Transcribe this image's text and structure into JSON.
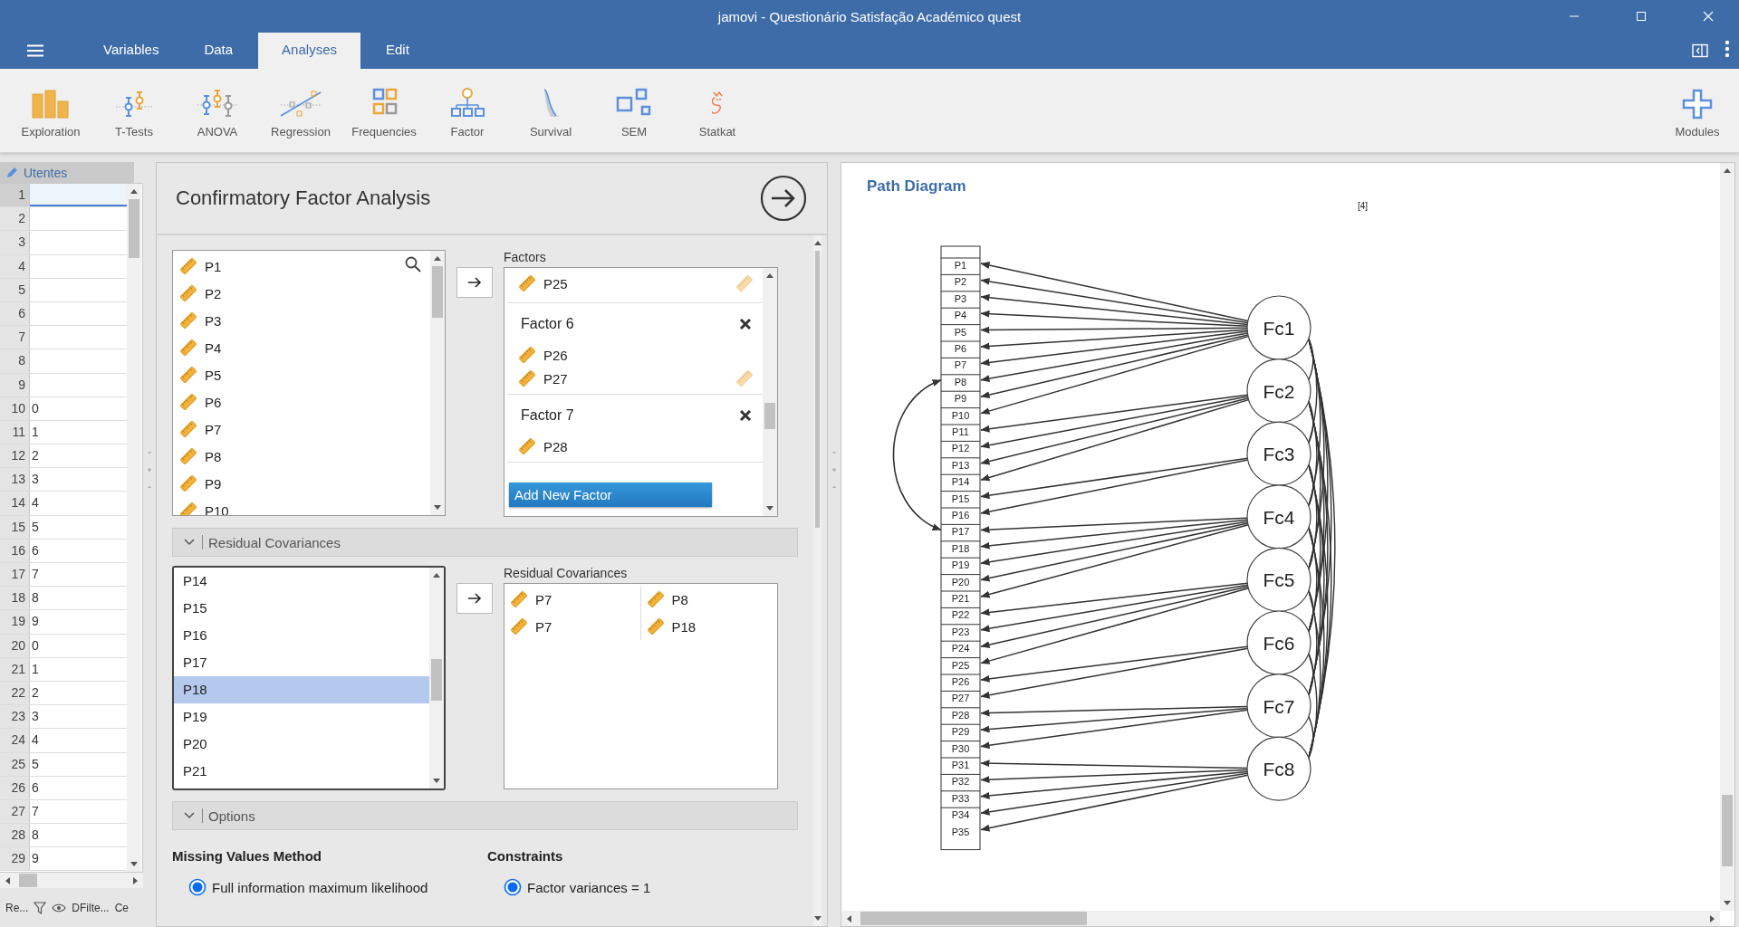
{
  "window": {
    "title": "jamovi - Questionário Satisfação Académico quest"
  },
  "tabs": [
    {
      "label": "Variables",
      "selected": false
    },
    {
      "label": "Data",
      "selected": false
    },
    {
      "label": "Analyses",
      "selected": true
    },
    {
      "label": "Edit",
      "selected": false
    }
  ],
  "ribbon": [
    {
      "kind": "exploration",
      "label": "Exploration"
    },
    {
      "kind": "ttests",
      "label": "T-Tests"
    },
    {
      "kind": "anova",
      "label": "ANOVA"
    },
    {
      "kind": "regression",
      "label": "Regression"
    },
    {
      "kind": "frequencies",
      "label": "Frequencies"
    },
    {
      "kind": "factor",
      "label": "Factor"
    },
    {
      "kind": "survival",
      "label": "Survival"
    },
    {
      "kind": "sem",
      "label": "SEM"
    },
    {
      "kind": "statkat",
      "label": "Statkat"
    },
    {
      "kind": "modules",
      "label": "Modules"
    }
  ],
  "spreadsheet": {
    "column": "Utentes",
    "rows": [
      {
        "number": "1",
        "selected": true
      },
      {
        "number": "2",
        "selected": false
      },
      {
        "number": "3",
        "selected": false
      },
      {
        "number": "4",
        "selected": false
      },
      {
        "number": "5",
        "selected": false
      },
      {
        "number": "6",
        "selected": false
      },
      {
        "number": "7",
        "selected": false
      },
      {
        "number": "8",
        "selected": false
      },
      {
        "number": "9",
        "selected": false
      },
      {
        "number": "10",
        "value": "0",
        "selected": false
      },
      {
        "number": "11",
        "value": "1",
        "selected": false
      },
      {
        "number": "12",
        "value": "2",
        "selected": false
      },
      {
        "number": "13",
        "value": "3",
        "selected": false
      },
      {
        "number": "14",
        "value": "4",
        "selected": false
      },
      {
        "number": "15",
        "value": "5",
        "selected": false
      },
      {
        "number": "16",
        "value": "6",
        "selected": false
      },
      {
        "number": "17",
        "value": "7",
        "selected": false
      },
      {
        "number": "18",
        "value": "8",
        "selected": false
      },
      {
        "number": "19",
        "value": "9",
        "selected": false
      },
      {
        "number": "20",
        "value": "0",
        "selected": false
      },
      {
        "number": "21",
        "value": "1",
        "selected": false
      },
      {
        "number": "22",
        "value": "2",
        "selected": false
      },
      {
        "number": "23",
        "value": "3",
        "selected": false
      },
      {
        "number": "24",
        "value": "4",
        "selected": false
      },
      {
        "number": "25",
        "value": "5",
        "selected": false
      },
      {
        "number": "26",
        "value": "6",
        "selected": false
      },
      {
        "number": "27",
        "value": "7",
        "selected": false
      },
      {
        "number": "28",
        "value": "8",
        "selected": false
      },
      {
        "number": "29",
        "value": "9",
        "selected": false
      }
    ]
  },
  "status_bar": [
    {
      "kind": "text",
      "label": "Re..."
    },
    {
      "kind": "filter"
    },
    {
      "kind": "eye"
    },
    {
      "kind": "text",
      "label": "DFilte..."
    },
    {
      "kind": "text",
      "label": "Ce"
    }
  ],
  "analysis": {
    "title": "Confirmatory Factor Analysis",
    "variables": [
      "P1",
      "P2",
      "P3",
      "P4",
      "P5",
      "P6",
      "P7",
      "P8",
      "P9",
      "P10"
    ],
    "factors_label": "Factors",
    "factor_items": [
      {
        "kind": "variable",
        "label": "P25",
        "faded_icon": true
      },
      {
        "kind": "factor",
        "label": "Factor 6"
      },
      {
        "kind": "variable",
        "label": "P26",
        "faded_icon": false
      },
      {
        "kind": "variable",
        "label": "P27",
        "faded_icon": true
      },
      {
        "kind": "factor",
        "label": "Factor 7"
      },
      {
        "kind": "variable",
        "label": "P28",
        "faded_icon": false
      }
    ],
    "add_factor_button": "Add New Factor",
    "residual_section": {
      "label": "Residual Covariances",
      "expanded": true
    },
    "residual_variables": [
      {
        "label": "P14",
        "selected": false
      },
      {
        "label": "P15",
        "selected": false
      },
      {
        "label": "P16",
        "selected": false
      },
      {
        "label": "P17",
        "selected": false
      },
      {
        "label": "P18",
        "selected": true
      },
      {
        "label": "P19",
        "selected": false
      },
      {
        "label": "P20",
        "selected": false
      },
      {
        "label": "P21",
        "selected": false
      }
    ],
    "residual_label": "Residual Covariances",
    "residual_pairs": [
      {
        "first": "P7",
        "second": "P8"
      },
      {
        "first": "P7",
        "second": "P18"
      }
    ],
    "options_section": {
      "label": "Options",
      "expanded": true
    },
    "missing_values": {
      "heading": "Missing Values Method",
      "options": [
        {
          "label": "Full information maximum likelihood",
          "selected": true
        }
      ]
    },
    "constraints": {
      "heading": "Constraints",
      "options": [
        {
          "label": "Factor variances = 1",
          "selected": true
        }
      ]
    }
  },
  "results": {
    "heading": "Path Diagram",
    "reference": "[4]",
    "factors": [
      {
        "label": "Fc1",
        "indicators": [
          {
            "label": "P1"
          },
          {
            "label": "P2"
          },
          {
            "label": "P3"
          },
          {
            "label": "P4"
          },
          {
            "label": "P5"
          },
          {
            "label": "P6"
          },
          {
            "label": "P7"
          },
          {
            "label": "P8",
            "arc_start": true
          },
          {
            "label": "P9"
          },
          {
            "label": "P10"
          }
        ]
      },
      {
        "label": "Fc2",
        "indicators": [
          {
            "label": "P11"
          },
          {
            "label": "P12"
          },
          {
            "label": "P13"
          },
          {
            "label": "P14"
          }
        ]
      },
      {
        "label": "Fc3",
        "indicators": [
          {
            "label": "P15"
          },
          {
            "label": "P16"
          }
        ]
      },
      {
        "label": "Fc4",
        "indicators": [
          {
            "label": "P17",
            "arc_end": true
          },
          {
            "label": "P18"
          },
          {
            "label": "P19"
          },
          {
            "label": "P20"
          },
          {
            "label": "P21"
          }
        ]
      },
      {
        "label": "Fc5",
        "indicators": [
          {
            "label": "P22"
          },
          {
            "label": "P23"
          },
          {
            "label": "P24"
          },
          {
            "label": "P25"
          }
        ]
      },
      {
        "label": "Fc6",
        "indicators": [
          {
            "label": "P26"
          },
          {
            "label": "P27"
          }
        ]
      },
      {
        "label": "Fc7",
        "indicators": [
          {
            "label": "P28"
          },
          {
            "label": "P29"
          },
          {
            "label": "P30"
          }
        ]
      },
      {
        "label": "Fc8",
        "indicators": [
          {
            "label": "P31"
          },
          {
            "label": "P32"
          },
          {
            "label": "P33"
          },
          {
            "label": "P34"
          },
          {
            "label": "P35"
          }
        ]
      }
    ]
  }
}
